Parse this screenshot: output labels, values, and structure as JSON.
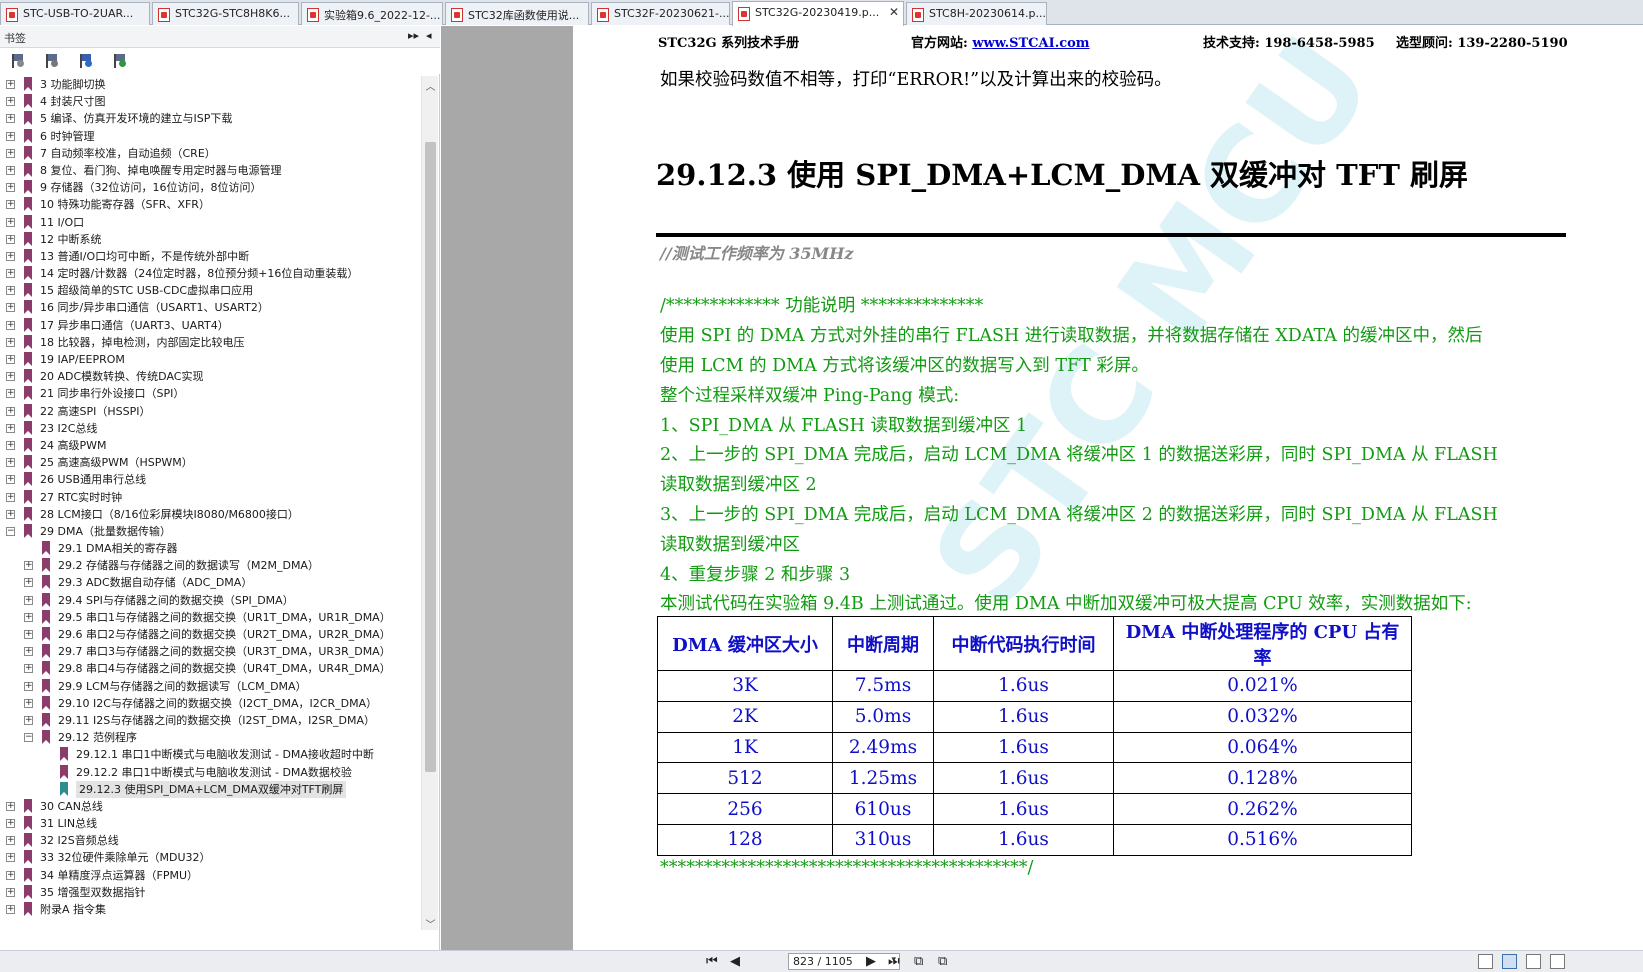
{
  "tabs": [
    {
      "label": "STC-USB-TO-2UAR...",
      "active": false
    },
    {
      "label": "STC32G-STC8H8K6...",
      "active": false
    },
    {
      "label": "实验箱9.6_2022-12-...",
      "active": false
    },
    {
      "label": "STC32库函数使用说...",
      "active": false
    },
    {
      "label": "STC32F-20230621-...",
      "active": false
    },
    {
      "label": "STC32G-20230419.p...",
      "active": true
    },
    {
      "label": "STC8H-20230614.p...",
      "active": false
    }
  ],
  "bookmarks_panel": {
    "title": "书签",
    "expand_all": "▸▸",
    "collapse": "◂",
    "items": [
      {
        "text": "3 功能脚切换",
        "level": 0,
        "expander": "+"
      },
      {
        "text": "4 封装尺寸图",
        "level": 0,
        "expander": "+"
      },
      {
        "text": "5 编译、仿真开发环境的建立与ISP下载",
        "level": 0,
        "expander": "+"
      },
      {
        "text": "6 时钟管理",
        "level": 0,
        "expander": "+"
      },
      {
        "text": "7 自动频率校准，自动追频（CRE）",
        "level": 0,
        "expander": "+"
      },
      {
        "text": "8 复位、看门狗、掉电唤醒专用定时器与电源管理",
        "level": 0,
        "expander": "+"
      },
      {
        "text": "9 存储器（32位访问，16位访问，8位访问）",
        "level": 0,
        "expander": "+"
      },
      {
        "text": "10 特殊功能寄存器（SFR、XFR）",
        "level": 0,
        "expander": "+"
      },
      {
        "text": "11 I/O口",
        "level": 0,
        "expander": "+"
      },
      {
        "text": "12 中断系统",
        "level": 0,
        "expander": "+"
      },
      {
        "text": "13 普通I/O口均可中断，不是传统外部中断",
        "level": 0,
        "expander": "+"
      },
      {
        "text": "14 定时器/计数器（24位定时器，8位预分频+16位自动重装载）",
        "level": 0,
        "expander": "+"
      },
      {
        "text": "15 超级简单的STC USB-CDC虚拟串口应用",
        "level": 0,
        "expander": "+"
      },
      {
        "text": "16 同步/异步串口通信（USART1、USART2）",
        "level": 0,
        "expander": "+"
      },
      {
        "text": "17 异步串口通信（UART3、UART4）",
        "level": 0,
        "expander": "+"
      },
      {
        "text": "18 比较器，掉电检测，内部固定比较电压",
        "level": 0,
        "expander": "+"
      },
      {
        "text": "19 IAP/EEPROM",
        "level": 0,
        "expander": "+"
      },
      {
        "text": "20 ADC模数转换、传统DAC实现",
        "level": 0,
        "expander": "+"
      },
      {
        "text": "21 同步串行外设接口（SPI）",
        "level": 0,
        "expander": "+"
      },
      {
        "text": "22 高速SPI（HSSPI）",
        "level": 0,
        "expander": "+"
      },
      {
        "text": "23 I2C总线",
        "level": 0,
        "expander": "+"
      },
      {
        "text": "24 高级PWM",
        "level": 0,
        "expander": "+"
      },
      {
        "text": "25 高速高级PWM（HSPWM）",
        "level": 0,
        "expander": "+"
      },
      {
        "text": "26 USB通用串行总线",
        "level": 0,
        "expander": "+"
      },
      {
        "text": "27 RTC实时时钟",
        "level": 0,
        "expander": "+"
      },
      {
        "text": "28 LCM接口（8/16位彩屏模块I8080/M6800接口）",
        "level": 0,
        "expander": "+"
      },
      {
        "text": "29 DMA（批量数据传输）",
        "level": 0,
        "expander": "−"
      },
      {
        "text": "29.1 DMA相关的寄存器",
        "level": 1,
        "expander": ""
      },
      {
        "text": "29.2 存储器与存储器之间的数据读写（M2M_DMA）",
        "level": 1,
        "expander": "+"
      },
      {
        "text": "29.3 ADC数据自动存储（ADC_DMA）",
        "level": 1,
        "expander": "+"
      },
      {
        "text": "29.4 SPI与存储器之间的数据交换（SPI_DMA）",
        "level": 1,
        "expander": "+"
      },
      {
        "text": "29.5 串口1与存储器之间的数据交换（UR1T_DMA，UR1R_DMA）",
        "level": 1,
        "expander": "+"
      },
      {
        "text": "29.6 串口2与存储器之间的数据交换（UR2T_DMA，UR2R_DMA）",
        "level": 1,
        "expander": "+"
      },
      {
        "text": "29.7 串口3与存储器之间的数据交换（UR3T_DMA，UR3R_DMA）",
        "level": 1,
        "expander": "+"
      },
      {
        "text": "29.8 串口4与存储器之间的数据交换（UR4T_DMA，UR4R_DMA）",
        "level": 1,
        "expander": "+"
      },
      {
        "text": "29.9 LCM与存储器之间的数据读写（LCM_DMA）",
        "level": 1,
        "expander": "+"
      },
      {
        "text": "29.10 I2C与存储器之间的数据交换（I2CT_DMA，I2CR_DMA）",
        "level": 1,
        "expander": "+"
      },
      {
        "text": "29.11 I2S与存储器之间的数据交换（I2ST_DMA，I2SR_DMA）",
        "level": 1,
        "expander": "+"
      },
      {
        "text": "29.12 范例程序",
        "level": 1,
        "expander": "−"
      },
      {
        "text": "29.12.1 串口1中断模式与电脑收发测试 - DMA接收超时中断",
        "level": 2,
        "expander": ""
      },
      {
        "text": "29.12.2 串口1中断模式与电脑收发测试 - DMA数据校验",
        "level": 2,
        "expander": ""
      },
      {
        "text": "29.12.3 使用SPI_DMA+LCM_DMA双缓冲对TFT刷屏",
        "level": 2,
        "expander": "",
        "selected": true
      },
      {
        "text": "30 CAN总线",
        "level": 0,
        "expander": "+"
      },
      {
        "text": "31 LIN总线",
        "level": 0,
        "expander": "+"
      },
      {
        "text": "32 I2S音频总线",
        "level": 0,
        "expander": "+"
      },
      {
        "text": "33 32位硬件乘除单元（MDU32）",
        "level": 0,
        "expander": "+"
      },
      {
        "text": "34 单精度浮点运算器（FPMU）",
        "level": 0,
        "expander": "+"
      },
      {
        "text": "35 增强型双数据指针",
        "level": 0,
        "expander": "+"
      },
      {
        "text": "附录A 指令集",
        "level": 0,
        "expander": "+"
      }
    ]
  },
  "page": {
    "header_manual": "STC32G 系列技术手册",
    "header_site_label": "官方网站: ",
    "header_site_url": "www.STCAI.com",
    "header_support": "技术支持: 198-6458-5985",
    "header_sales": "选型顾问: 139-2280-5190",
    "prev_line": "如果校验码数值不相等，打印“ERROR!”以及计算出来的校验码。",
    "section_title": "29.12.3    使用 SPI_DMA+LCM_DMA 双缓冲对 TFT 刷屏",
    "code_comment": "//测试工作频率为 35MHz",
    "func_header": "/*************    功能说明    **************",
    "desc_lines": [
      "使用 SPI 的 DMA 方式对外挂的串行 FLASH 进行读取数据，并将数据存储在 XDATA 的缓冲区中，然后",
      "使用 LCM 的 DMA 方式将该缓冲区的数据写入到 TFT 彩屏。",
      "整个过程采样双缓冲 Ping-Pang 模式:",
      "1、SPI_DMA 从 FLASH 读取数据到缓冲区 1",
      "2、上一步的 SPI_DMA 完成后，启动 LCM_DMA 将缓冲区 1 的数据送彩屏，同时 SPI_DMA 从 FLASH",
      "读取数据到缓冲区 2",
      "3、上一步的 SPI_DMA 完成后，启动 LCM_DMA 将缓冲区 2 的数据送彩屏，同时 SPI_DMA 从 FLASH",
      "读取数据到缓冲区",
      "4、重复步骤 2 和步骤 3",
      "本测试代码在实验箱 9.4B 上测试通过。使用 DMA 中断加双缓冲可极大提高 CPU 效率，实测数据如下:"
    ],
    "table": {
      "headers": [
        "DMA 缓冲区大小",
        "中断周期",
        "中断代码执行时间",
        "DMA 中断处理程序的 CPU 占有率"
      ],
      "rows": [
        [
          "3K",
          "7.5ms",
          "1.6us",
          "0.021%"
        ],
        [
          "2K",
          "5.0ms",
          "1.6us",
          "0.032%"
        ],
        [
          "1K",
          "2.49ms",
          "1.6us",
          "0.064%"
        ],
        [
          "512",
          "1.25ms",
          "1.6us",
          "0.128%"
        ],
        [
          "256",
          "610us",
          "1.6us",
          "0.262%"
        ],
        [
          "128",
          "310us",
          "1.6us",
          "0.516%"
        ]
      ]
    },
    "end_comment": "******************************************/",
    "watermark": "STC MCU"
  },
  "statusbar": {
    "page_indicator": "823 / 1105"
  },
  "colors": {
    "green_text": "#129b12",
    "table_text": "#1010c8",
    "bookmark_icon": "#8c3c6b",
    "bookmark_icon_selected": "#2f8c8c",
    "gutter": "#a8a8a8"
  }
}
